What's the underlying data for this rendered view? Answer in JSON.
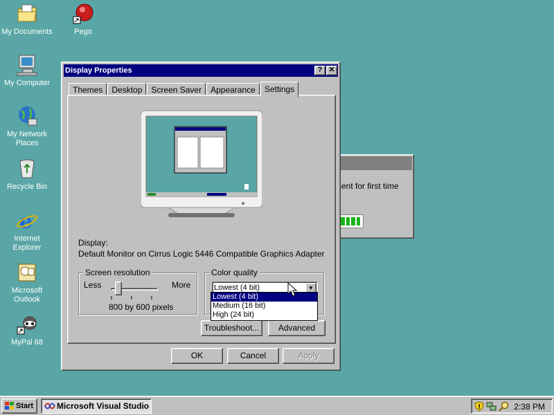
{
  "desktop": {
    "icons": [
      {
        "label": "My Documents"
      },
      {
        "label": "Pego"
      },
      {
        "label": "My Computer"
      },
      {
        "label": "My Network Places"
      },
      {
        "label": "Recycle Bin"
      },
      {
        "label": "Internet Explorer"
      },
      {
        "label": "Microsoft Outlook"
      },
      {
        "label": "MyPal 68"
      }
    ]
  },
  "background_window": {
    "text": "ment for first time"
  },
  "dialog": {
    "title": "Display Properties",
    "help_label": "?",
    "close_label": "✕",
    "tabs": [
      {
        "label": "Themes"
      },
      {
        "label": "Desktop"
      },
      {
        "label": "Screen Saver"
      },
      {
        "label": "Appearance"
      },
      {
        "label": "Settings",
        "active": true
      }
    ],
    "display_label": "Display:",
    "display_value": "Default Monitor on Cirrus Logic 5446 Compatible Graphics Adapter",
    "resolution": {
      "legend": "Screen resolution",
      "less": "Less",
      "more": "More",
      "value": "800 by 600 pixels",
      "slider_level": 0.1
    },
    "color_quality": {
      "legend": "Color quality",
      "selected": "Lowest (4 bit)",
      "options": [
        {
          "label": "Lowest (4 bit)",
          "selected": true
        },
        {
          "label": "Medium (16 bit)"
        },
        {
          "label": "High (24 bit)"
        }
      ]
    },
    "buttons": {
      "troubleshoot": "Troubleshoot...",
      "advanced": "Advanced",
      "ok": "OK",
      "cancel": "Cancel",
      "apply": "Apply"
    }
  },
  "taskbar": {
    "start_label": "Start",
    "task_item": "Microsoft Visual Studio",
    "clock": "2:38 PM"
  },
  "colors": {
    "desktop": "#5aa6a6",
    "titlebar": "#000080",
    "face": "#c0c0c0"
  }
}
